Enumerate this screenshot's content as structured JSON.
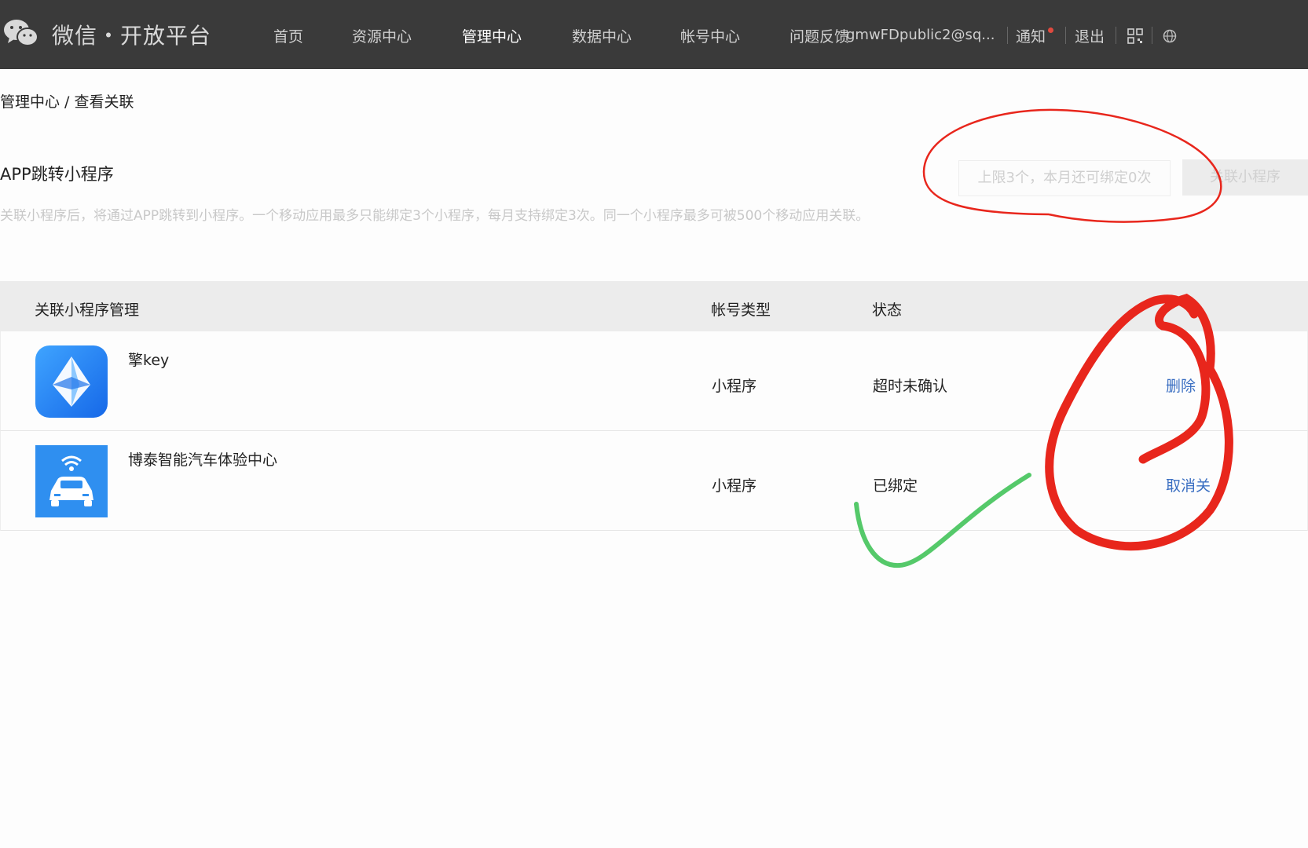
{
  "header": {
    "logo_text": "微信・开放平台",
    "nav": [
      "首页",
      "资源中心",
      "管理中心",
      "数据中心",
      "帐号中心"
    ],
    "active_nav": "管理中心",
    "feedback": "问题反馈",
    "account": "gmwFDpublic2@sq...",
    "notify": "通知",
    "logout": "退出"
  },
  "breadcrumb": "管理中心 / 查看关联",
  "section": {
    "title": "APP跳转小程序",
    "description": "关联小程序后，将通过APP跳转到小程序。一个移动应用最多只能绑定3个小程序，每月支持绑定3次。同一个小程序最多可被500个移动应用关联。",
    "quota": "上限3个，本月还可绑定0次",
    "link_button": "关联小程序"
  },
  "table": {
    "headers": [
      "关联小程序管理",
      "帐号类型",
      "状态"
    ],
    "rows": [
      {
        "name": "擎key",
        "type": "小程序",
        "status": "超时未确认",
        "action": "删除"
      },
      {
        "name": "博泰智能汽车体验中心",
        "type": "小程序",
        "status": "已绑定",
        "action": "取消关"
      }
    ]
  },
  "colors": {
    "topbar": "#3a3a3a",
    "link": "#3b6fc2",
    "annotation_red": "#e8261c",
    "annotation_green": "#55c96a"
  }
}
